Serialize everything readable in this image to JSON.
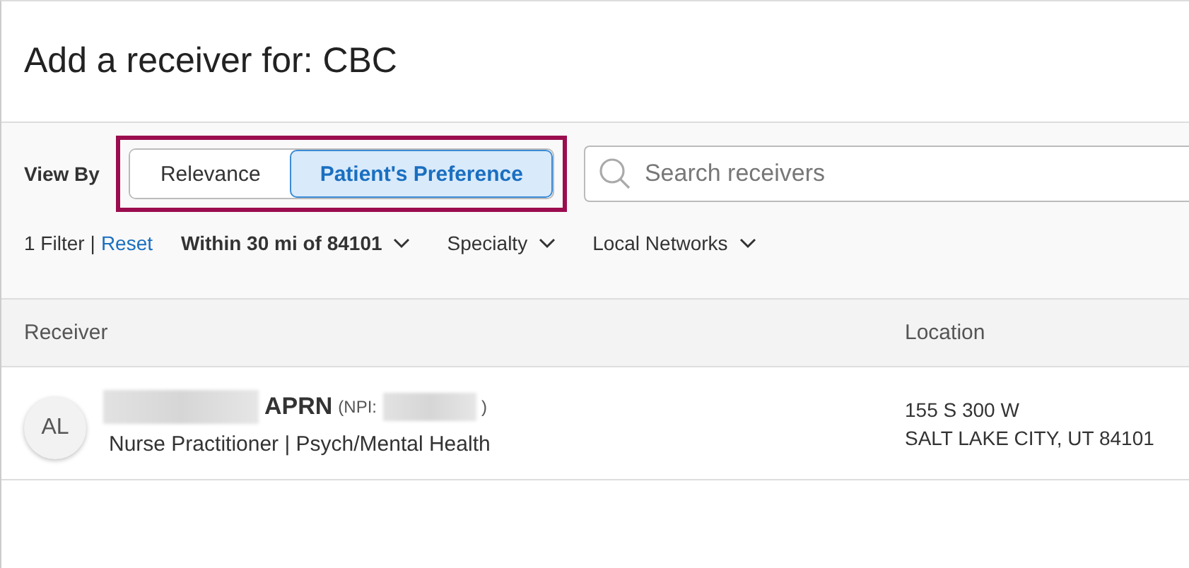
{
  "title": "Add a receiver for: CBC",
  "view_by": {
    "label": "View By",
    "highlighted": true,
    "options": [
      {
        "label": "Relevance",
        "selected": false
      },
      {
        "label": "Patient's Preference",
        "selected": true
      }
    ]
  },
  "search": {
    "placeholder": "Search receivers"
  },
  "filters": {
    "count": "1 Filter",
    "separator": "|",
    "reset": "Reset",
    "dropdowns": [
      {
        "label": "Within 30 mi of 84101",
        "active": true
      },
      {
        "label": "Specialty",
        "active": false
      },
      {
        "label": "Local Networks",
        "active": false
      }
    ]
  },
  "table": {
    "columns": [
      "Receiver",
      "Location"
    ],
    "rows": [
      {
        "initials": "AL",
        "name_redacted": true,
        "credential": "APRN",
        "npi_prefix": "(NPI:",
        "npi_redacted": true,
        "npi_suffix": ")",
        "specialty": "Nurse Practitioner | Psych/Mental Health",
        "address_line_1": "155 S 300 W",
        "address_line_2": "SALT LAKE CITY, UT 84101"
      }
    ]
  }
}
